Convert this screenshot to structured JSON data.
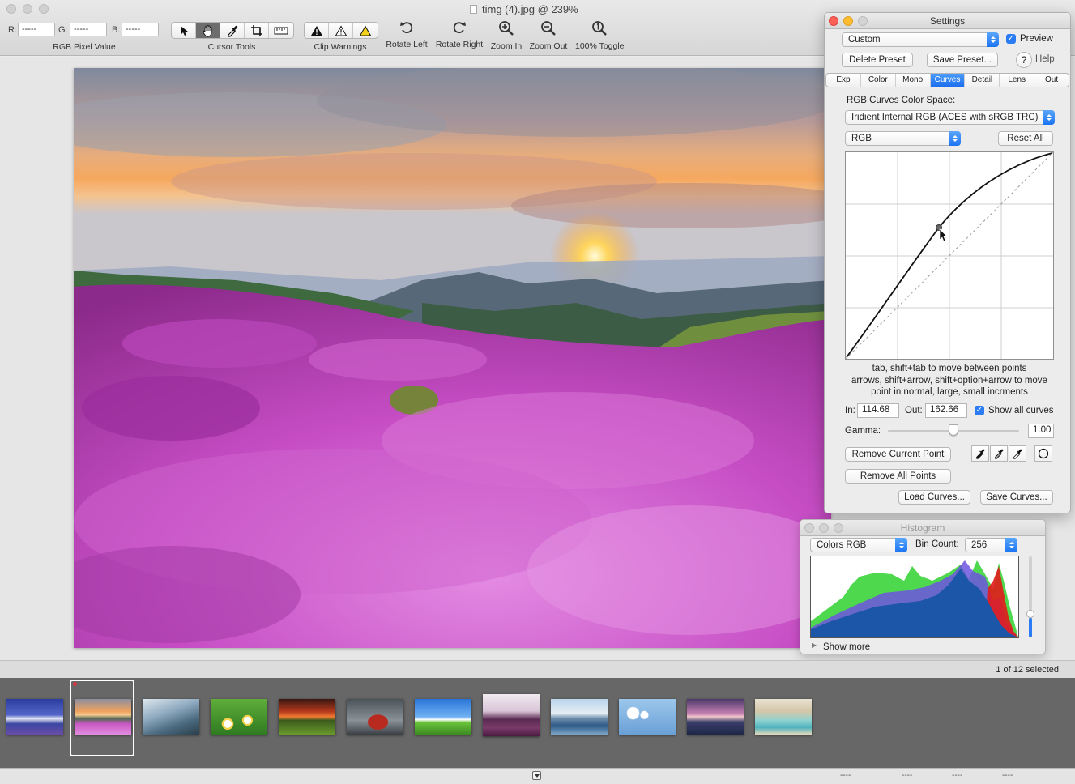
{
  "window": {
    "title": "timg (4).jpg @ 239%"
  },
  "toolbar": {
    "rgb": {
      "r_label": "R:",
      "g_label": "G:",
      "b_label": "B:",
      "r_value": "-----",
      "g_value": "-----",
      "b_value": "-----",
      "caption": "RGB Pixel Value"
    },
    "cursor_tools_caption": "Cursor Tools",
    "clip_warnings_caption": "Clip Warnings",
    "rotate_left": "Rotate Left",
    "rotate_right": "Rotate Right",
    "zoom_in": "Zoom In",
    "zoom_out": "Zoom Out",
    "toggle_100": "100% Toggle"
  },
  "settings": {
    "title": "Settings",
    "preset": "Custom",
    "preview_label": "Preview",
    "delete_preset": "Delete Preset",
    "save_preset": "Save Preset...",
    "help_label": "Help",
    "tabs": [
      {
        "label": "Exp",
        "active": false
      },
      {
        "label": "Color",
        "active": false
      },
      {
        "label": "Mono",
        "active": false
      },
      {
        "label": "Curves",
        "active": true
      },
      {
        "label": "Detail",
        "active": false
      },
      {
        "label": "Lens",
        "active": false
      },
      {
        "label": "Out",
        "active": false
      }
    ],
    "color_space_label": "RGB Curves Color Space:",
    "color_space_value": "Iridient Internal RGB (ACES with sRGB TRC)",
    "channel": "RGB",
    "reset_all": "Reset All",
    "help_text_1": "tab, shift+tab to move between points",
    "help_text_2": "arrows, shift+arrow, shift+option+arrow to move",
    "help_text_3": "point in normal, large, small incrments",
    "in_label": "In:",
    "in_value": "114.68",
    "out_label": "Out:",
    "out_value": "162.66",
    "show_all_curves": "Show all curves",
    "gamma_label": "Gamma:",
    "gamma_value": "1.00",
    "remove_current_point": "Remove Current Point",
    "remove_all_points": "Remove All Points",
    "load_curves": "Load Curves...",
    "save_curves": "Save Curves..."
  },
  "histogram": {
    "title": "Histogram",
    "mode": "Colors RGB",
    "bin_count_label": "Bin Count:",
    "bin_count": "256",
    "show_more": "Show more"
  },
  "filmstrip": {
    "selection": "1 of 12 selected",
    "thumbnails": [
      "mountain-lake-blue",
      "pink-flower-field",
      "beach-birds",
      "daisies",
      "sunset-field",
      "red-car",
      "green-hill-blue-sky",
      "purple-lake",
      "blue-lake-reflection",
      "dandelions",
      "purple-sunset-sea",
      "sandy-beach"
    ]
  },
  "status_bar": {
    "d1": "----",
    "d2": "----",
    "d3": "----",
    "d4": "----"
  },
  "colors": {
    "accent": "#1d6ff0",
    "strip": "#676767"
  }
}
